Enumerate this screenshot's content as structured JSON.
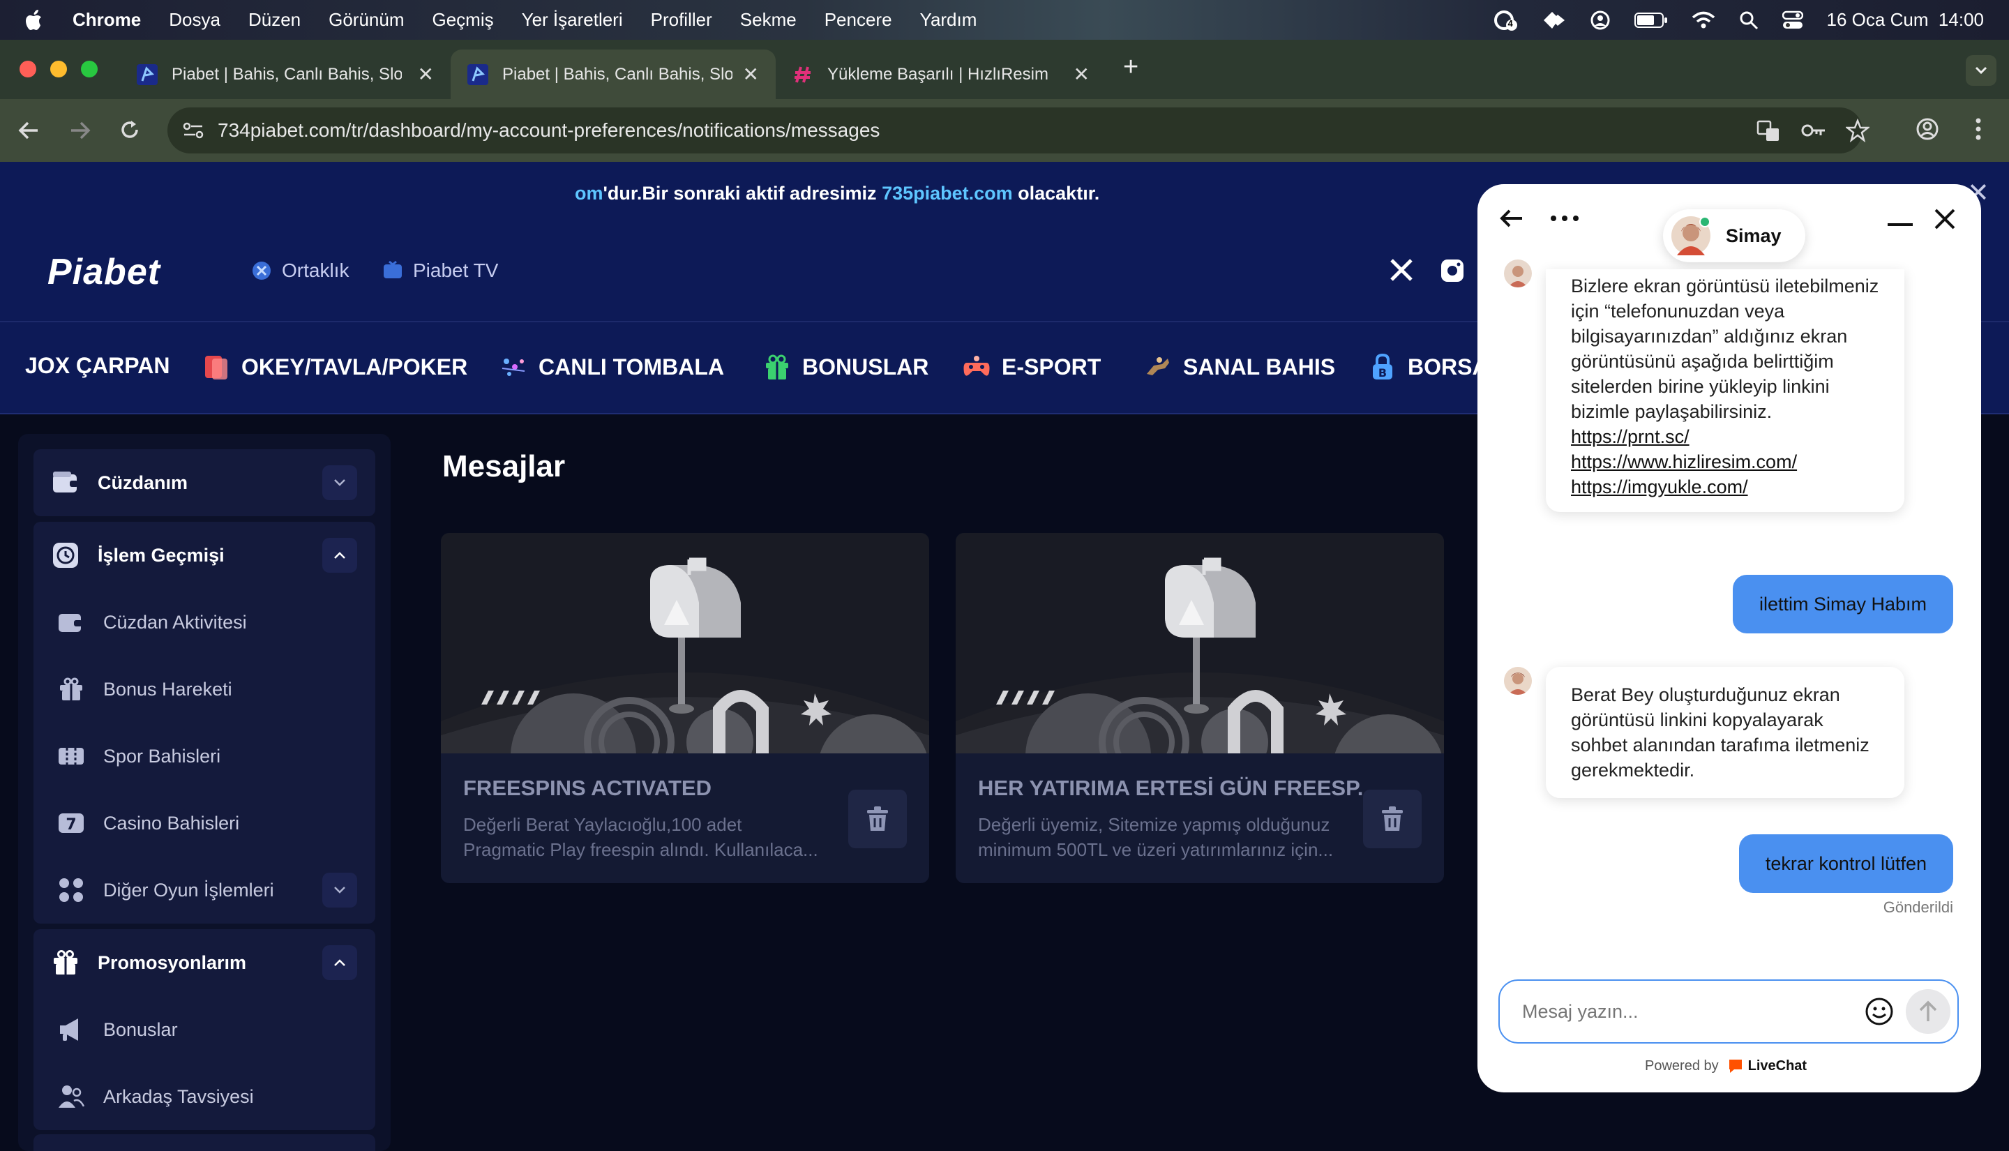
{
  "menubar": {
    "app": "Chrome",
    "items": [
      "Dosya",
      "Düzen",
      "Görünüm",
      "Geçmiş",
      "Yer İşaretleri",
      "Profiller",
      "Sekme",
      "Pencere",
      "Yardım"
    ],
    "clock": "16 Oca Cum  14:00",
    "badge": "4"
  },
  "tabs": [
    {
      "title": "Piabet | Bahis, Canlı Bahis, Slot"
    },
    {
      "title": "Piabet | Bahis, Canlı Bahis, Slot"
    },
    {
      "title": "Yükleme Başarılı | HızlıResim"
    }
  ],
  "address": {
    "url": "734piabet.com/tr/dashboard/my-account-preferences/notifications/messages"
  },
  "banner": {
    "prefix": "om",
    "text": "'dur.Bir sonraki aktif adresimiz ",
    "link": "735piabet.com",
    "suffix": " olacaktır."
  },
  "site": {
    "logo": "Piabet",
    "header_links": [
      "Ortaklık",
      "Piabet TV"
    ],
    "nav": [
      "JOX ÇARPAN",
      "OKEY/TAVLA/POKER",
      "CANLI TOMBALA",
      "BONUSLAR",
      "E-SPORT",
      "SANAL BAHIS",
      "BORSA"
    ]
  },
  "sidebar": {
    "wallet": "Cüzdanım",
    "history": {
      "label": "İşlem Geçmişi",
      "items": [
        "Cüzdan Aktivitesi",
        "Bonus Hareketi",
        "Spor Bahisleri",
        "Casino Bahisleri",
        "Diğer Oyun İşlemleri"
      ]
    },
    "promos": {
      "label": "Promosyonlarım",
      "items": [
        "Bonuslar",
        "Arkadaş Tavsiyesi"
      ]
    }
  },
  "page": {
    "title": "Mesajlar"
  },
  "messages": [
    {
      "title": "FREESPINS ACTIVATED",
      "line1": "Değerli Berat Yaylacıoğlu,100 adet",
      "line2": "Pragmatic Play freespin alındı. Kullanılaca..."
    },
    {
      "title": "HER YATIRIMA ERTESİ GÜN FREESP...",
      "line1": "Değerli üyemiz, Sitemize yapmış olduğunuz",
      "line2": "minimum 500TL ve üzeri yatırımlarınız için..."
    }
  ],
  "chat": {
    "agent": "Simay",
    "bot1": {
      "text": "Bizlere ekran görüntüsü iletebilmeniz için “telefonunuzdan veya bilgisayarınızdan” aldığınız ekran görüntüsünü aşağıda belirttiğim sitelerden birine yükleyip linkini bizimle paylaşabilirsiniz.",
      "links": [
        "https://prnt.sc/",
        "https://www.hizliresim.com/",
        "https://imgyukle.com/"
      ]
    },
    "user1": "ilettim Simay Habım",
    "bot2": "Berat Bey oluşturduğunuz ekran görüntüsü linkini kopyalayarak sohbet alanından tarafıma iletmeniz gerekmektedir.",
    "user2": "tekrar kontrol lütfen",
    "status": "Gönderildi",
    "input_placeholder": "Mesaj yazın...",
    "powered_by": "Powered by",
    "brand": "LiveChat"
  },
  "colors": {
    "site_bg": "#0d1a57",
    "accent_link": "#5ec6ff",
    "user_bubble": "#4a90f0",
    "livechat": "#ff5100"
  }
}
